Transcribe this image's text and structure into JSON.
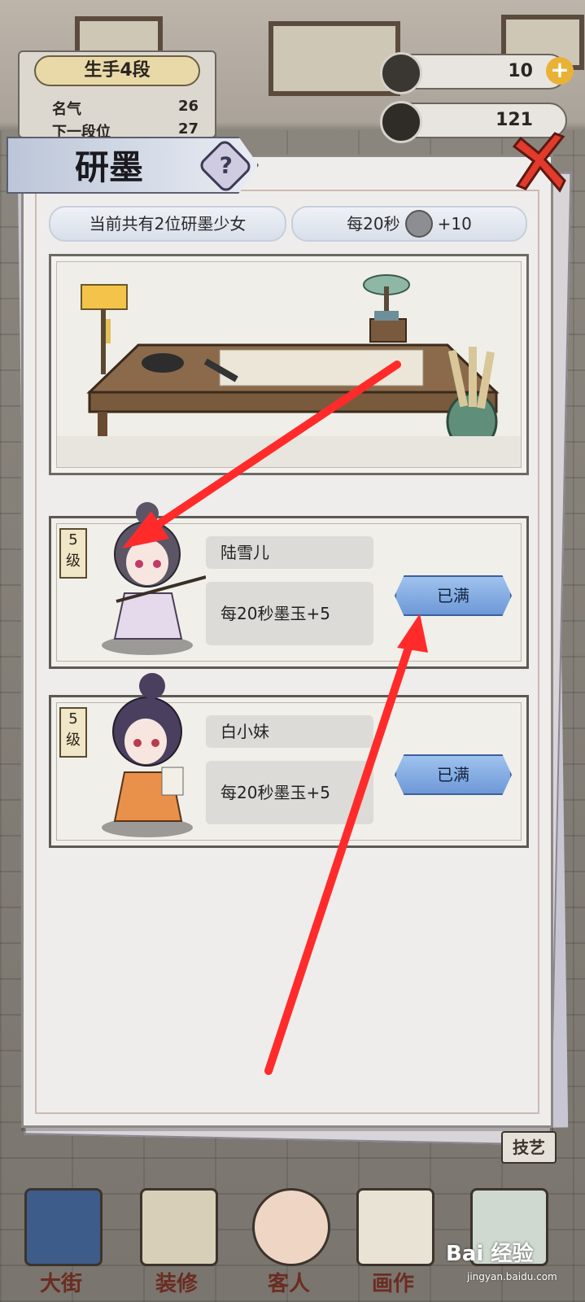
{
  "hud": {
    "rank_title": "生手4段",
    "fame_label": "名气",
    "fame_value": "26",
    "next_rank_label": "下一段位",
    "next_rank_value": "27",
    "ink_jade_amount": "10",
    "coin_amount": "121"
  },
  "modal": {
    "title": "研墨",
    "help_symbol": "?",
    "girls_count_text": "当前共有2位研墨少女",
    "rate_prefix": "每20秒",
    "rate_suffix": "+10"
  },
  "cards": [
    {
      "level_num": "5",
      "level_unit": "级",
      "name": "陆雪儿",
      "rate": "每20秒墨玉+5",
      "button": "已满"
    },
    {
      "level_num": "5",
      "level_unit": "级",
      "name": "白小妹",
      "rate": "每20秒墨玉+5",
      "button": "已满"
    }
  ],
  "bottom_nav": {
    "street": "大街",
    "decorate": "装修",
    "guests": "客人",
    "painting": "画作",
    "skills_tag": "技艺"
  },
  "watermark": {
    "brand": "Bai 经验",
    "url": "jingyan.baidu.com"
  },
  "colors": {
    "annotation_arrow": "#ff2b2b",
    "full_button": "#7aa3de",
    "accent_gold": "#e9b237"
  }
}
